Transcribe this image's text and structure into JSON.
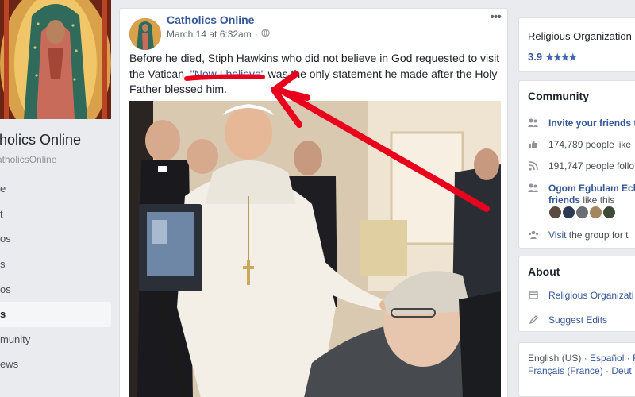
{
  "left": {
    "page_name": "Catholics Online",
    "page_name_visible": "tholics Online",
    "handle_visible": "atholicsOnline",
    "nav": [
      "e",
      "t",
      "os",
      "s",
      "os",
      "s",
      "munity",
      "ews"
    ],
    "active_index": 5
  },
  "post": {
    "author": "Catholics Online",
    "timestamp": "March 14 at 6:32am",
    "separator": "·",
    "text_before": "Before he died, Stiph Hawkins who did not believe in God requested to visit the Vatican. ",
    "quote": "\"Now I believe\"",
    "text_after": " was the only statement he made after the Holy Father blessed him.",
    "more_icon": "more-horizontal-icon",
    "privacy_icon": "globe-icon"
  },
  "right": {
    "category": "Religious Organization",
    "rating_value": "3.9",
    "stars": "★★★★",
    "community": {
      "title": "Community",
      "invite": "Invite your friends t",
      "likes": "174,789 people like",
      "follows": "191,747 people follo",
      "friends_name": "Ogom Egbulam Ech",
      "friends_suffix_link": "friends",
      "friends_suffix_rest": " like this",
      "visit_link": "Visit",
      "visit_rest": " the group for t"
    },
    "about": {
      "title": "About",
      "category": "Religious Organizati",
      "suggest": "Suggest Edits"
    },
    "languages": {
      "line1_a": "English (US)",
      "line1_sep": " · ",
      "line1_b": "Español",
      "line1_c": " · F",
      "line2_a": "Français (France)",
      "line2_sep": " · ",
      "line2_b": "Deut"
    }
  },
  "colors": {
    "link": "#365899",
    "annotation": "#e8001c",
    "background": "#e9ebee"
  }
}
